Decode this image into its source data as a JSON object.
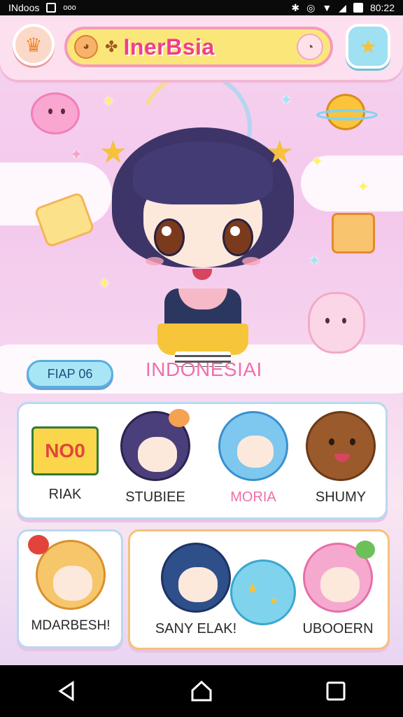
{
  "status_bar": {
    "left_text": "INdoos",
    "dots": "ooo",
    "time": "80:22"
  },
  "header": {
    "title": "InerBsia",
    "menu_icon": "sofa-icon",
    "star_icon": "star-icon"
  },
  "hero": {
    "tag_label": "FIAP 06",
    "character_name": "INDONESIAI"
  },
  "cards_top": [
    {
      "label": "RIAK",
      "icon": "sign-icon",
      "sign_text": "NO0"
    },
    {
      "label": "STUBIEE",
      "icon": "purple-hair-character-icon"
    },
    {
      "label": "MORIA",
      "icon": "blue-cat-character-icon"
    },
    {
      "label": "SHUMY",
      "icon": "bear-cookie-icon"
    }
  ],
  "cards_bottom": [
    {
      "label": "MDARBESH!",
      "icon": "blonde-character-icon"
    },
    {
      "label": "SANY ELAK!",
      "icon": "blue-hair-character-icon"
    },
    {
      "label": "",
      "icon": "bubble-orb-icon"
    },
    {
      "label": "UBOOERN",
      "icon": "pink-hair-character-icon"
    }
  ],
  "colors": {
    "accent_pink": "#ee3f8d",
    "title_yellow": "#fbe779",
    "sky_blue": "#a8e6f6",
    "background_pink": "#f6d3f0"
  }
}
